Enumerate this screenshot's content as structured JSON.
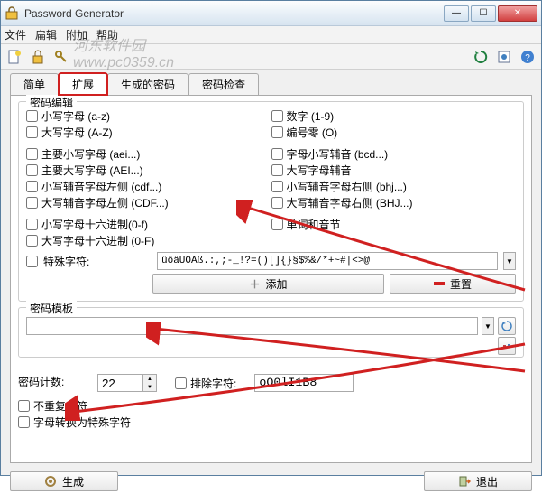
{
  "window": {
    "title": "Password Generator"
  },
  "menu": {
    "file": "文件",
    "view": "扁辑",
    "addon": "附加",
    "help": "帮助"
  },
  "watermark": "河东软件园\nwww.pc0359.cn",
  "tabs": {
    "simple": "简单",
    "extended": "扩展",
    "generated": "生成的密码",
    "check": "密码检查"
  },
  "group": {
    "edit_title": "密码编辑",
    "template_title": "密码模板"
  },
  "checks": {
    "lower": "小写字母 (a-z)",
    "upper": "大写字母 (A-Z)",
    "digits": "数字 (1-9)",
    "zero": "编号零 (O)",
    "vowel_lower": "主要小写字母 (aei...)",
    "vowel_upper": "主要大写字母 (AEI...)",
    "alpha_lower_cons": "字母小写辅音 (bcd...)",
    "alpha_upper_cons": "大写字母辅音",
    "cons_lower_left": "小写辅音字母左侧 (cdf...)",
    "cons_upper_left": "大写辅音字母左侧 (CDF...)",
    "cons_lower_right": "小写辅音字母右侧 (bhj...)",
    "cons_upper_right": "大写辅音字母右侧 (BHJ...)",
    "hex_lower": "小写字母十六进制(0-f)",
    "hex_upper": "大写字母十六进制 (0-F)",
    "syllable": "单词和音节",
    "special": "特殊字符:",
    "count_label": "密码计数:",
    "exclude": "排除字符:",
    "no_repeat": "不重复字符",
    "convert": "字母转换为特殊字符"
  },
  "inputs": {
    "special_value": "üöäÜÖÄß.:,;-_!?=()[]{}§$%&/*+~#|<>@",
    "count_value": "22",
    "exclude_value": "oO0lI1B8"
  },
  "buttons": {
    "add": "添加",
    "reset": "重置",
    "generate": "生成",
    "exit": "退出"
  }
}
